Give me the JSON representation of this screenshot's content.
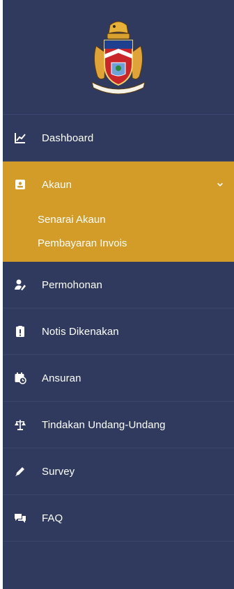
{
  "nav": {
    "dashboard": {
      "label": "Dashboard",
      "icon": "chart-line-icon"
    },
    "akaun": {
      "label": "Akaun",
      "icon": "id-card-icon",
      "expanded": true,
      "items": [
        {
          "label": "Senarai Akaun"
        },
        {
          "label": "Pembayaran Invois"
        }
      ]
    },
    "permohonan": {
      "label": "Permohonan",
      "icon": "user-edit-icon"
    },
    "notis": {
      "label": "Notis Dikenakan",
      "icon": "clipboard-alert-icon"
    },
    "ansuran": {
      "label": "Ansuran",
      "icon": "calendar-clock-icon"
    },
    "tindakan": {
      "label": "Tindakan Undang-Undang",
      "icon": "scale-icon"
    },
    "survey": {
      "label": "Survey",
      "icon": "pencil-icon"
    },
    "faq": {
      "label": "FAQ",
      "icon": "chat-icon"
    }
  },
  "colors": {
    "sidebar_bg": "#2f3a5e",
    "active_bg": "#d39b27",
    "text": "#ffffff"
  }
}
